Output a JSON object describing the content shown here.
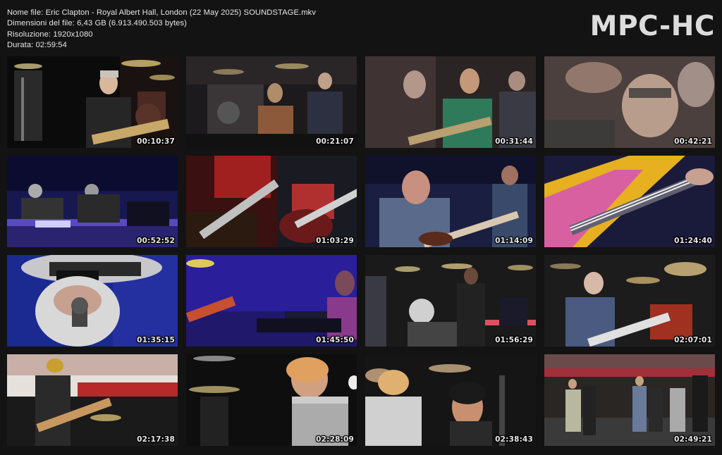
{
  "file_info": {
    "name_line": "Nome file: Eric Clapton - Royal Albert Hall, London (22 May 2025) SOUNDSTAGE.mkv",
    "size_line": "Dimensioni del file: 6,43 GB (6.913.490.503 bytes)",
    "resolution_line": "Risoluzione: 1920x1080",
    "duration_line": "Durata: 02:59:54"
  },
  "logo_text": "MPC-HC",
  "thumbnails": [
    {
      "timestamp": "00:10:37"
    },
    {
      "timestamp": "00:21:07"
    },
    {
      "timestamp": "00:31:44"
    },
    {
      "timestamp": "00:42:21"
    },
    {
      "timestamp": "00:52:52"
    },
    {
      "timestamp": "01:03:29"
    },
    {
      "timestamp": "01:14:09"
    },
    {
      "timestamp": "01:24:40"
    },
    {
      "timestamp": "01:35:15"
    },
    {
      "timestamp": "01:45:50"
    },
    {
      "timestamp": "01:56:29"
    },
    {
      "timestamp": "02:07:01"
    },
    {
      "timestamp": "02:17:38"
    },
    {
      "timestamp": "02:28:09"
    },
    {
      "timestamp": "02:38:43"
    },
    {
      "timestamp": "02:49:21"
    }
  ]
}
